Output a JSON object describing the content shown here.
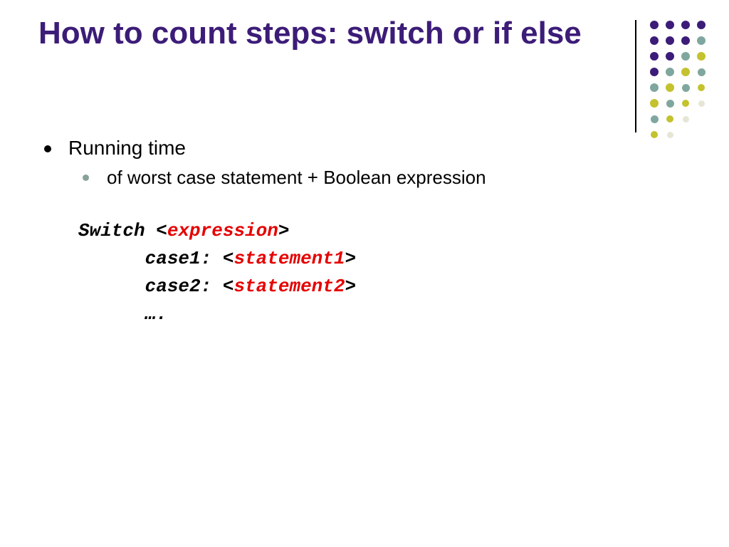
{
  "title": "How to count steps: switch or if else",
  "bullets": {
    "l1": "Running time",
    "l2": "of worst case statement + Boolean expression"
  },
  "code": {
    "line1_a": "Switch <",
    "line1_b": "expression",
    "line1_c": ">",
    "line2_a": "case1: <",
    "line2_b": "statement1",
    "line2_c": ">",
    "line3_a": "case2: <",
    "line3_b": "statement2",
    "line3_c": ">",
    "line4": "…."
  },
  "dot_grid": {
    "colors": {
      "purple": "#3c1c78",
      "teal": "#7fa79f",
      "olive": "#c4c22e",
      "faint": "#e6e6d6"
    },
    "rows": [
      [
        {
          "c": "purple",
          "s": 12
        },
        {
          "c": "purple",
          "s": 12
        },
        {
          "c": "purple",
          "s": 12
        },
        {
          "c": "purple",
          "s": 12
        }
      ],
      [
        {
          "c": "purple",
          "s": 12
        },
        {
          "c": "purple",
          "s": 12
        },
        {
          "c": "purple",
          "s": 12
        },
        {
          "c": "teal",
          "s": 12
        }
      ],
      [
        {
          "c": "purple",
          "s": 12
        },
        {
          "c": "purple",
          "s": 12
        },
        {
          "c": "teal",
          "s": 12
        },
        {
          "c": "olive",
          "s": 12
        }
      ],
      [
        {
          "c": "purple",
          "s": 12
        },
        {
          "c": "teal",
          "s": 12
        },
        {
          "c": "olive",
          "s": 12
        },
        {
          "c": "teal",
          "s": 11
        }
      ],
      [
        {
          "c": "teal",
          "s": 12
        },
        {
          "c": "olive",
          "s": 12
        },
        {
          "c": "teal",
          "s": 11
        },
        {
          "c": "olive",
          "s": 10
        }
      ],
      [
        {
          "c": "olive",
          "s": 12
        },
        {
          "c": "teal",
          "s": 11
        },
        {
          "c": "olive",
          "s": 10
        },
        {
          "c": "faint",
          "s": 9
        }
      ],
      [
        {
          "c": "teal",
          "s": 11
        },
        {
          "c": "olive",
          "s": 10
        },
        {
          "c": "faint",
          "s": 9
        },
        {
          "c": "faint",
          "s": 0
        }
      ],
      [
        {
          "c": "olive",
          "s": 10
        },
        {
          "c": "faint",
          "s": 9
        },
        {
          "c": "faint",
          "s": 0
        },
        {
          "c": "faint",
          "s": 0
        }
      ]
    ],
    "cell": 22
  }
}
